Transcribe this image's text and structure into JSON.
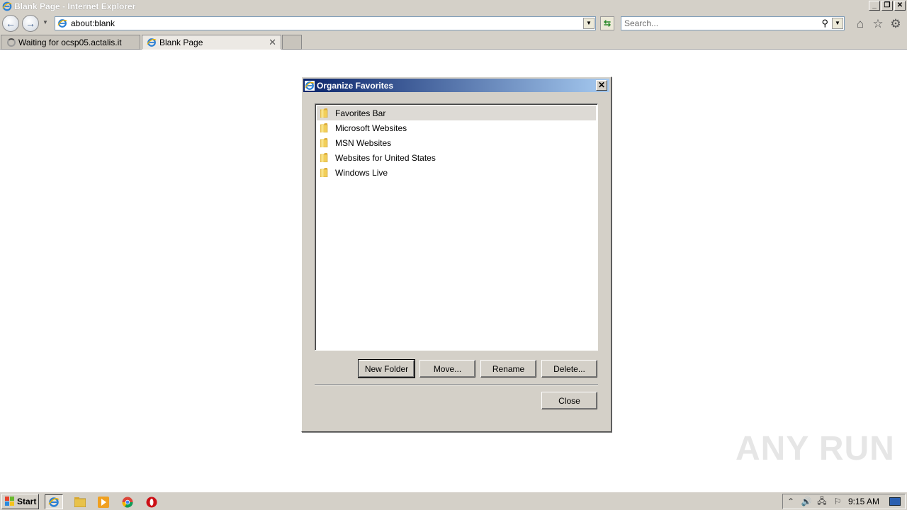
{
  "window": {
    "title": "Blank Page - Internet Explorer"
  },
  "navigation": {
    "address": "about:blank",
    "search_placeholder": "Search..."
  },
  "tabs": [
    {
      "label": "Waiting for ocsp05.actalis.it",
      "state": "loading"
    },
    {
      "label": "Blank Page",
      "state": "active"
    }
  ],
  "dialog": {
    "title": "Organize Favorites",
    "folders": [
      {
        "label": "Favorites Bar",
        "selected": true
      },
      {
        "label": "Microsoft Websites",
        "selected": false
      },
      {
        "label": "MSN Websites",
        "selected": false
      },
      {
        "label": "Websites for United States",
        "selected": false
      },
      {
        "label": "Windows Live",
        "selected": false
      }
    ],
    "buttons": {
      "new_folder": "New Folder",
      "move": "Move...",
      "rename": "Rename",
      "delete": "Delete...",
      "close": "Close"
    }
  },
  "watermark": "ANY RUN",
  "taskbar": {
    "start_label": "Start",
    "clock": "9:15 AM"
  },
  "colors": {
    "dialog_title_start": "#0a246a",
    "dialog_title_end": "#a6caf0",
    "chrome_gray": "#d4d0c8"
  }
}
